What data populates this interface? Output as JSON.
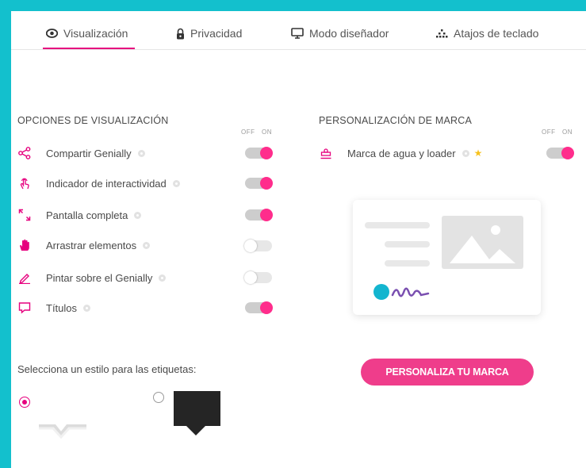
{
  "tabs": [
    {
      "label": "Visualización",
      "icon": "eye-icon",
      "active": true
    },
    {
      "label": "Privacidad",
      "icon": "lock-icon",
      "active": false
    },
    {
      "label": "Modo diseñador",
      "icon": "monitor-icon",
      "active": false
    },
    {
      "label": "Atajos de teclado",
      "icon": "keyboard-shortcuts-icon",
      "active": false
    }
  ],
  "display_options": {
    "title": "OPCIONES DE VISUALIZACIÓN",
    "off_label": "OFF",
    "on_label": "ON",
    "items": [
      {
        "label": "Compartir Genially",
        "icon": "share-icon",
        "enabled": true
      },
      {
        "label": "Indicador de interactividad",
        "icon": "touch-icon",
        "enabled": true
      },
      {
        "label": "Pantalla completa",
        "icon": "fullscreen-icon",
        "enabled": true
      },
      {
        "label": "Arrastrar elementos",
        "icon": "hand-icon",
        "enabled": false
      },
      {
        "label": "Pintar sobre el Genially",
        "icon": "pencil-icon",
        "enabled": false
      },
      {
        "label": "Títulos",
        "icon": "speech-bubble-icon",
        "enabled": true
      }
    ]
  },
  "branding": {
    "title": "PERSONALIZACIÓN DE MARCA",
    "off_label": "OFF",
    "on_label": "ON",
    "item": {
      "label": "Marca de agua y loader",
      "icon": "stamp-icon",
      "enabled": true,
      "premium_icon": "star-icon"
    },
    "button_label": "PERSONALIZA TU MARCA"
  },
  "labels_style": {
    "title": "Selecciona un estilo para las etiquetas:",
    "options": [
      {
        "style": "light",
        "selected": true
      },
      {
        "style": "dark",
        "selected": false
      }
    ]
  },
  "colors": {
    "accent": "#e6007e",
    "toggle_on": "#ff2d8c",
    "frame": "#13c0cd",
    "button": "#ef3d8b"
  }
}
